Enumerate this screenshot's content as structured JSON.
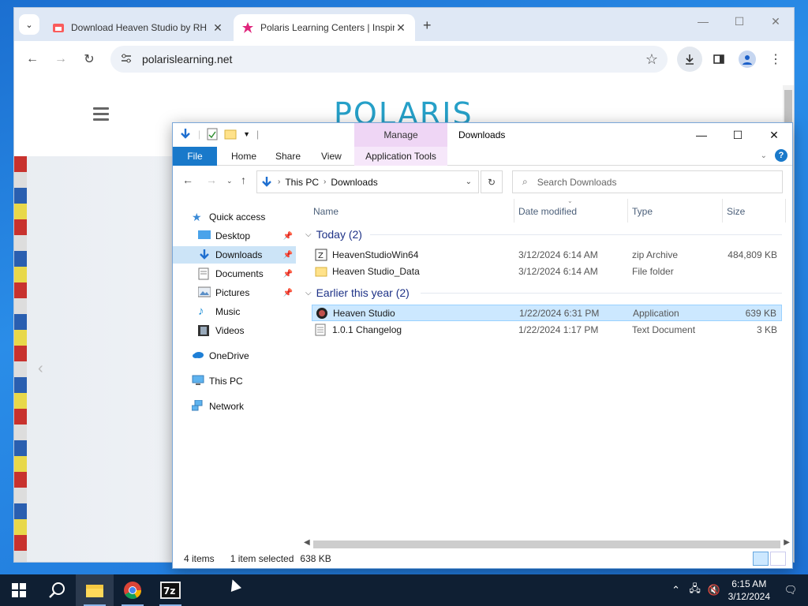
{
  "browser": {
    "tabs": [
      {
        "title": "Download Heaven Studio by RH",
        "active": false
      },
      {
        "title": "Polaris Learning Centers | Inspir",
        "active": true
      }
    ],
    "url": "polarislearning.net",
    "page_logo": "POLARIS"
  },
  "explorer": {
    "title": "Downloads",
    "manage_tab": "Manage",
    "ribbon_tabs": {
      "file": "File",
      "home": "Home",
      "share": "Share",
      "view": "View",
      "app_tools": "Application Tools"
    },
    "breadcrumb": [
      "This PC",
      "Downloads"
    ],
    "search_placeholder": "Search Downloads",
    "nav": {
      "quick_access": "Quick access",
      "desktop": "Desktop",
      "downloads": "Downloads",
      "documents": "Documents",
      "pictures": "Pictures",
      "music": "Music",
      "videos": "Videos",
      "onedrive": "OneDrive",
      "this_pc": "This PC",
      "network": "Network"
    },
    "columns": {
      "name": "Name",
      "date": "Date modified",
      "type": "Type",
      "size": "Size"
    },
    "groups": {
      "today": "Today (2)",
      "earlier": "Earlier this year (2)"
    },
    "files": [
      {
        "name": "HeavenStudioWin64",
        "date": "3/12/2024 6:14 AM",
        "type": "zip Archive",
        "size": "484,809 KB"
      },
      {
        "name": "Heaven Studio_Data",
        "date": "3/12/2024 6:14 AM",
        "type": "File folder",
        "size": ""
      },
      {
        "name": "Heaven Studio",
        "date": "1/22/2024 6:31 PM",
        "type": "Application",
        "size": "639 KB"
      },
      {
        "name": "1.0.1 Changelog",
        "date": "1/22/2024 1:17 PM",
        "type": "Text Document",
        "size": "3 KB"
      }
    ],
    "status": {
      "items": "4 items",
      "selected": "1 item selected",
      "size": "638 KB"
    }
  },
  "taskbar": {
    "time": "6:15 AM",
    "date": "3/12/2024"
  }
}
